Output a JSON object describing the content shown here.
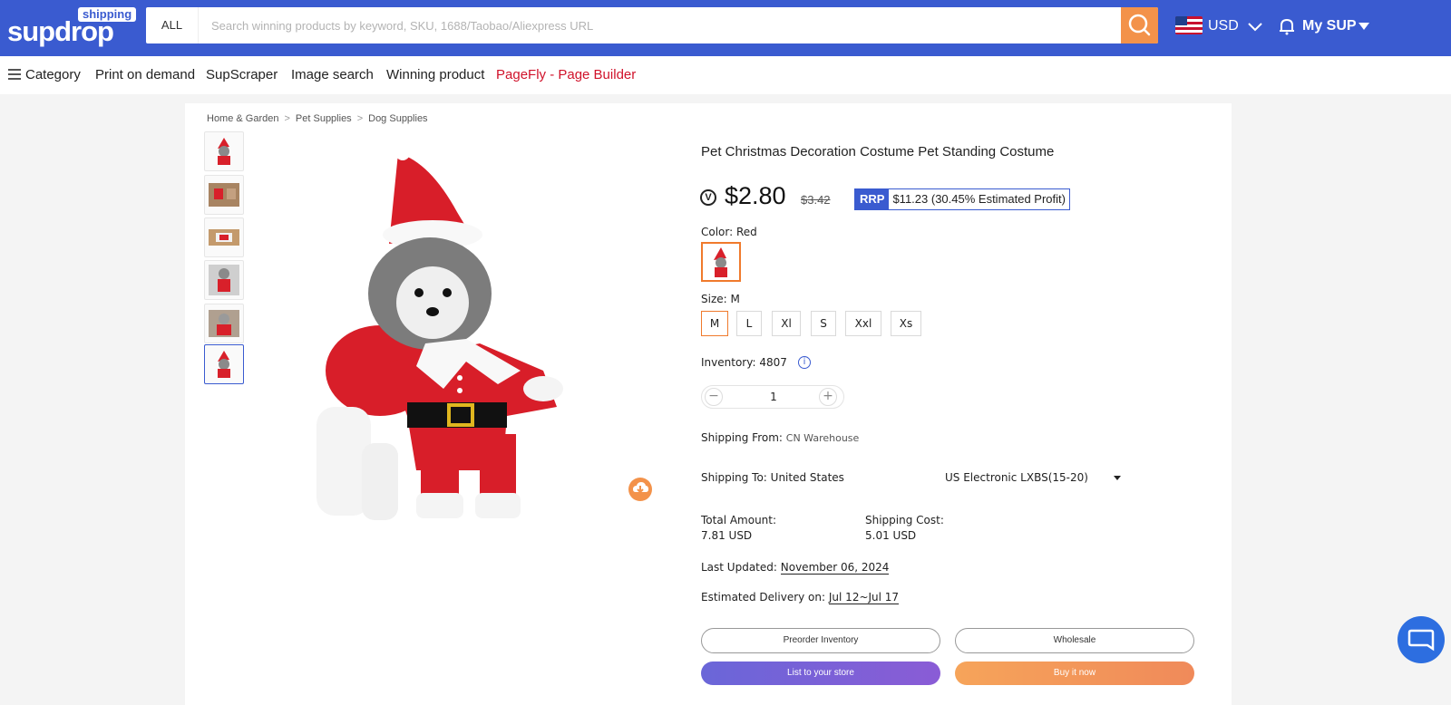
{
  "header": {
    "logo_text": "supdrop",
    "logo_badge": "shipping",
    "search_category": "ALL",
    "search_placeholder": "Search winning products by keyword, SKU, 1688/Taobao/Aliexpress URL",
    "currency": "USD",
    "account_label": "My SUP",
    "brand_color": "#3a5bd0",
    "search_button_color": "#f3924a"
  },
  "nav": {
    "items": [
      "Category",
      "Print on demand",
      "SupScraper",
      "Image search",
      "Winning product",
      "PageFly - Page Builder"
    ]
  },
  "breadcrumb": [
    "Home & Garden",
    "Pet Supplies",
    "Dog Supplies"
  ],
  "product": {
    "title": "Pet Christmas Decoration Costume Pet Standing Costume",
    "price": "$2.80",
    "old_price": "$3.42",
    "rrp_tag": "RRP",
    "rrp_value": "$11.23 (30.45% Estimated Profit)",
    "color_label": "Color:",
    "color_value": "Red",
    "size_label": "Size:",
    "size_value": "M",
    "sizes": [
      "M",
      "L",
      "Xl",
      "S",
      "Xxl",
      "Xs"
    ],
    "inventory_label": "Inventory:",
    "inventory_value": "4807",
    "quantity": "1",
    "shipping_from_label": "Shipping From:",
    "shipping_from_value": "CN Warehouse",
    "shipping_to_label": "Shipping To:",
    "shipping_to_value": "United States",
    "shipping_method": "US Electronic LXBS(15-20)",
    "total_amount_label": "Total Amount:",
    "total_amount_value": "7.81 USD",
    "shipping_cost_label": "Shipping Cost:",
    "shipping_cost_value": "5.01 USD",
    "last_updated_label": "Last Updated:",
    "last_updated_value": "November 06, 2024",
    "delivery_label": "Estimated Delivery on:",
    "delivery_value": "Jul 12~Jul 17"
  },
  "actions": {
    "preorder": "Preorder Inventory",
    "wholesale": "Wholesale",
    "list_to_store": "List to your store",
    "buy_now": "Buy it now"
  }
}
